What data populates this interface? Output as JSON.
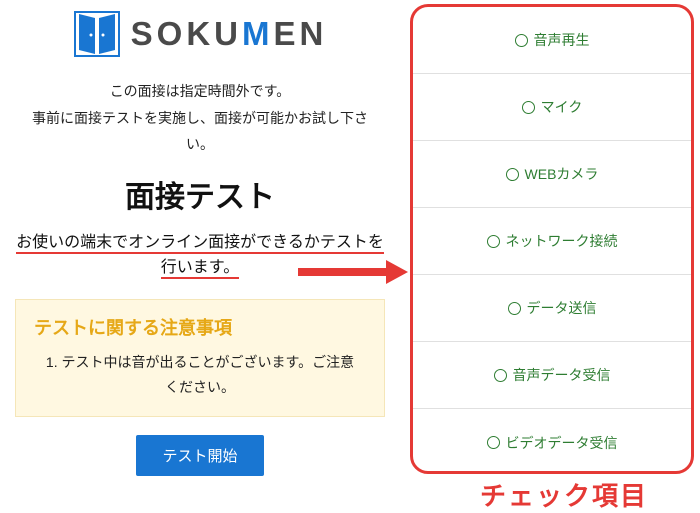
{
  "logo": {
    "text_prefix": "SOKU",
    "text_accent": "M",
    "text_suffix": "EN"
  },
  "notice": {
    "line1": "この面接は指定時間外です。",
    "line2": "事前に面接テストを実施し、面接が可能かお試し下さい。"
  },
  "heading": "面接テスト",
  "subhead": {
    "part1": "お使いの端末でオンライン面接ができるかテストを",
    "part2": "行います。"
  },
  "caution": {
    "title": "テストに関する注意事項",
    "items": [
      "テスト中は音が出ることがございます。ご注意ください。"
    ]
  },
  "start_button": "テスト開始",
  "check_items": [
    "音声再生",
    "マイク",
    "WEBカメラ",
    "ネットワーク接続",
    "データ送信",
    "音声データ受信",
    "ビデオデータ受信"
  ],
  "check_label": "チェック項目",
  "colors": {
    "accent_blue": "#1976D2",
    "highlight_red": "#E53935",
    "status_green": "#2E7D32",
    "caution_bg": "#FFF8E1",
    "caution_title": "#E6A817"
  }
}
